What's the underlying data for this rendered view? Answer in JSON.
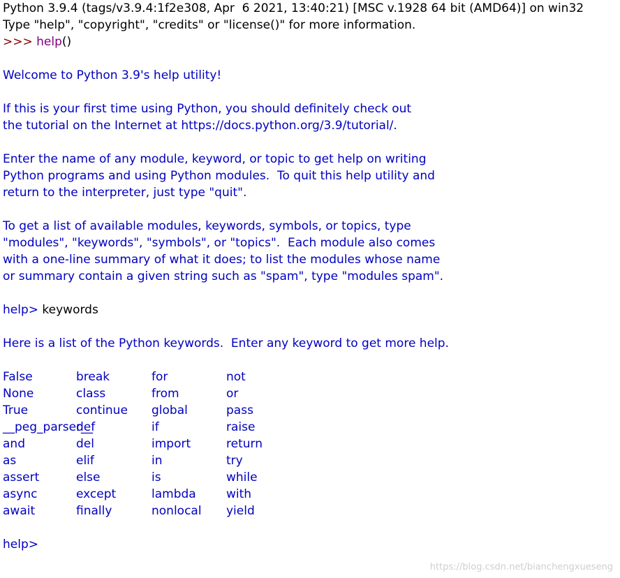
{
  "shell": {
    "banner": [
      "Python 3.9.4 (tags/v3.9.4:1f2e308, Apr  6 2021, 13:40:21) [MSC v.1928 64 bit (AMD64)] on win32",
      "Type \"help\", \"copyright\", \"credits\" or \"license()\" for more information."
    ],
    "input_line": {
      "prompt": ">>> ",
      "call": "help",
      "parens": "()"
    },
    "welcome": "Welcome to Python 3.9's help utility!",
    "paragraph1": [
      "If this is your first time using Python, you should definitely check out",
      "the tutorial on the Internet at https://docs.python.org/3.9/tutorial/."
    ],
    "paragraph2": [
      "Enter the name of any module, keyword, or topic to get help on writing",
      "Python programs and using Python modules.  To quit this help utility and",
      "return to the interpreter, just type \"quit\"."
    ],
    "paragraph3": [
      "To get a list of available modules, keywords, symbols, or topics, type",
      "\"modules\", \"keywords\", \"symbols\", or \"topics\".  Each module also comes",
      "with a one-line summary of what it does; to list the modules whose name",
      "or summary contain a given string such as \"spam\", type \"modules spam\"."
    ],
    "help_prompt": "help> ",
    "help_command": "keywords",
    "keywords_intro": "Here is a list of the Python keywords.  Enter any keyword to get more help.",
    "keywords": [
      [
        "False",
        "break",
        "for",
        "not"
      ],
      [
        "None",
        "class",
        "from",
        "or"
      ],
      [
        "True",
        "continue",
        "global",
        "pass"
      ],
      [
        "__peg_parser__",
        "def",
        "if",
        "raise"
      ],
      [
        "and",
        "del",
        "import",
        "return"
      ],
      [
        "as",
        "elif",
        "in",
        "try"
      ],
      [
        "assert",
        "else",
        "is",
        "while"
      ],
      [
        "async",
        "except",
        "lambda",
        "with"
      ],
      [
        "await",
        "finally",
        "nonlocal",
        "yield"
      ]
    ],
    "final_prompt": "help>"
  },
  "watermark": "https://blog.csdn.net/bianchengxueseng",
  "colors": {
    "output": "#0000c0",
    "prompt": "#7f0000",
    "builtin": "#800080",
    "stdin": "#000000",
    "background": "#ffffff"
  }
}
